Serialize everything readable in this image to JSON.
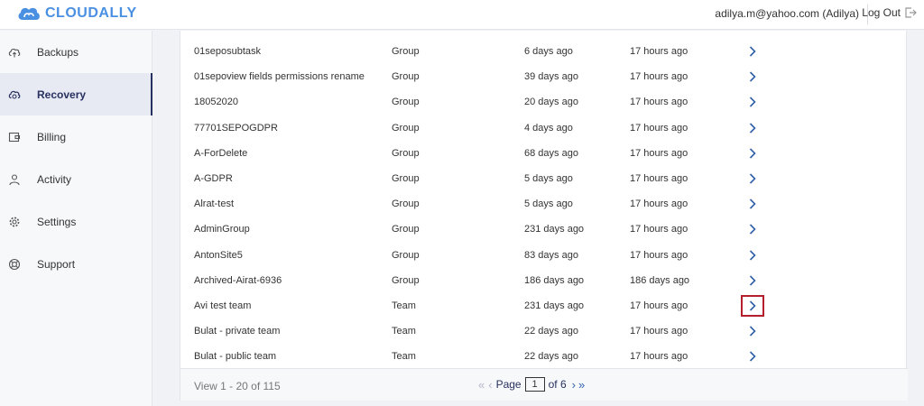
{
  "brand": {
    "name": "CLOUDALLY",
    "color": "#4a90e2"
  },
  "user": {
    "email": "adilya.m@yahoo.com (Adilya)"
  },
  "logout_label": "Log Out",
  "sidebar": {
    "items": [
      {
        "label": "Backups",
        "icon": "cloud-upload-icon"
      },
      {
        "label": "Recovery",
        "icon": "cloud-restore-icon",
        "active": true
      },
      {
        "label": "Billing",
        "icon": "billing-icon"
      },
      {
        "label": "Activity",
        "icon": "person-icon"
      },
      {
        "label": "Settings",
        "icon": "gear-icon"
      },
      {
        "label": "Support",
        "icon": "lifebuoy-icon"
      }
    ]
  },
  "table": {
    "rows": [
      {
        "name": "01seposubtask",
        "type": "Group",
        "created": "6 days ago",
        "updated": "17 hours ago"
      },
      {
        "name": "01sepoview fields permissions rename",
        "type": "Group",
        "created": "39 days ago",
        "updated": "17 hours ago"
      },
      {
        "name": "18052020",
        "type": "Group",
        "created": "20 days ago",
        "updated": "17 hours ago"
      },
      {
        "name": "77701SEPOGDPR",
        "type": "Group",
        "created": "4 days ago",
        "updated": "17 hours ago"
      },
      {
        "name": "A-ForDelete",
        "type": "Group",
        "created": "68 days ago",
        "updated": "17 hours ago"
      },
      {
        "name": "A-GDPR",
        "type": "Group",
        "created": "5 days ago",
        "updated": "17 hours ago"
      },
      {
        "name": "Alrat-test",
        "type": "Group",
        "created": "5 days ago",
        "updated": "17 hours ago"
      },
      {
        "name": "AdminGroup",
        "type": "Group",
        "created": "231 days ago",
        "updated": "17 hours ago"
      },
      {
        "name": "AntonSite5",
        "type": "Group",
        "created": "83 days ago",
        "updated": "17 hours ago"
      },
      {
        "name": "Archived-Airat-6936",
        "type": "Group",
        "created": "186 days ago",
        "updated": "186 days ago"
      },
      {
        "name": "Avi test team",
        "type": "Team",
        "created": "231 days ago",
        "updated": "17 hours ago",
        "highlight": true
      },
      {
        "name": "Bulat - private team",
        "type": "Team",
        "created": "22 days ago",
        "updated": "17 hours ago"
      },
      {
        "name": "Bulat - public team",
        "type": "Team",
        "created": "22 days ago",
        "updated": "17 hours ago"
      }
    ]
  },
  "footer": {
    "view_count": "View 1 - 20 of 115",
    "page_label": "Page",
    "page_value": "1",
    "of_label": "of 6",
    "first_icon": "double-chevron-left-icon",
    "prev_icon": "chevron-left-icon",
    "next_icon": "chevron-right-icon",
    "last_icon": "double-chevron-right-icon"
  }
}
